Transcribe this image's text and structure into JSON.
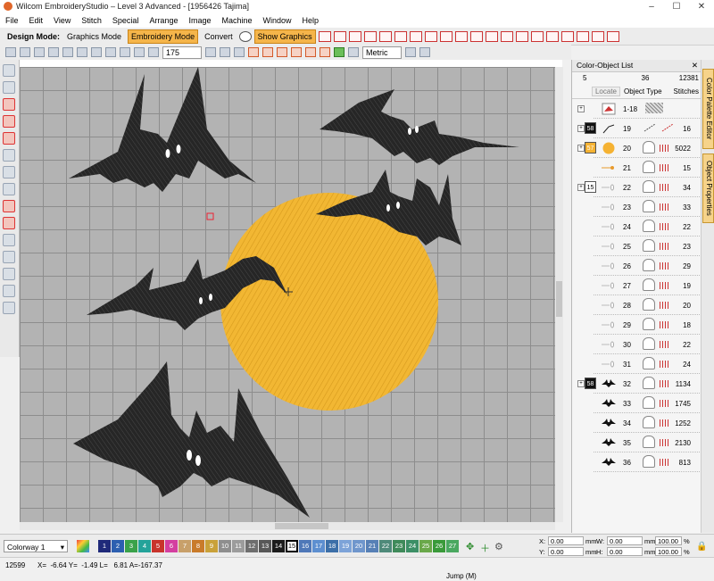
{
  "window": {
    "title": "Wilcom EmbroideryStudio – Level 3 Advanced - [1956426        Tajima]",
    "controls": [
      "–",
      "☐",
      "✕"
    ]
  },
  "menu": [
    "File",
    "Edit",
    "View",
    "Stitch",
    "Special",
    "Arrange",
    "Image",
    "Machine",
    "Window",
    "Help"
  ],
  "modebar": {
    "label": "Design Mode:",
    "graphics_mode": "Graphics Mode",
    "embroidery_mode": "Embroidery Mode",
    "convert": "Convert",
    "show_graphics": "Show Graphics"
  },
  "toolbar2": {
    "zoom": "175",
    "units": "Metric"
  },
  "panel": {
    "title": "Color-Object List",
    "close": "✕",
    "pin": "📌",
    "summary": {
      "colors": "5",
      "objects": "36",
      "stitches": "12381"
    },
    "cols": {
      "locate": "Locate",
      "object_type": "Object Type",
      "stitches": "Stitches"
    },
    "rows": [
      {
        "num": "1-18",
        "stitches": "",
        "swatch": "",
        "swatch_color": "",
        "kind": "group"
      },
      {
        "num": "19",
        "stitches": "16",
        "swatch": "58",
        "swatch_color": "#111111",
        "kind": "line"
      },
      {
        "num": "20",
        "stitches": "5022",
        "swatch": "57",
        "swatch_color": "#f5b232",
        "kind": "moon"
      },
      {
        "num": "21",
        "stitches": "15",
        "swatch": "",
        "swatch_color": "",
        "kind": "dot"
      },
      {
        "num": "22",
        "stitches": "34",
        "swatch": "15",
        "swatch_color": "#ffffff",
        "kind": "white"
      },
      {
        "num": "23",
        "stitches": "33",
        "swatch": "",
        "swatch_color": "",
        "kind": "white"
      },
      {
        "num": "24",
        "stitches": "22",
        "swatch": "",
        "swatch_color": "",
        "kind": "white"
      },
      {
        "num": "25",
        "stitches": "23",
        "swatch": "",
        "swatch_color": "",
        "kind": "white"
      },
      {
        "num": "26",
        "stitches": "29",
        "swatch": "",
        "swatch_color": "",
        "kind": "white"
      },
      {
        "num": "27",
        "stitches": "19",
        "swatch": "",
        "swatch_color": "",
        "kind": "white"
      },
      {
        "num": "28",
        "stitches": "20",
        "swatch": "",
        "swatch_color": "",
        "kind": "white"
      },
      {
        "num": "29",
        "stitches": "18",
        "swatch": "",
        "swatch_color": "",
        "kind": "white"
      },
      {
        "num": "30",
        "stitches": "22",
        "swatch": "",
        "swatch_color": "",
        "kind": "white"
      },
      {
        "num": "31",
        "stitches": "24",
        "swatch": "",
        "swatch_color": "",
        "kind": "white"
      },
      {
        "num": "32",
        "stitches": "1134",
        "swatch": "58",
        "swatch_color": "#111111",
        "kind": "bat"
      },
      {
        "num": "33",
        "stitches": "1745",
        "swatch": "",
        "swatch_color": "",
        "kind": "bat"
      },
      {
        "num": "34",
        "stitches": "1252",
        "swatch": "",
        "swatch_color": "",
        "kind": "bat"
      },
      {
        "num": "35",
        "stitches": "2130",
        "swatch": "",
        "swatch_color": "",
        "kind": "bat"
      },
      {
        "num": "36",
        "stitches": "813",
        "swatch": "",
        "swatch_color": "",
        "kind": "bat"
      }
    ],
    "side_tabs": [
      "Color Palette Editor",
      "Object Properties"
    ]
  },
  "colorway": {
    "name": "Colorway 1",
    "selected": "15"
  },
  "chips": [
    {
      "n": "1",
      "c": "#1f2a7a"
    },
    {
      "n": "2",
      "c": "#2c5fb0"
    },
    {
      "n": "3",
      "c": "#3aa24a"
    },
    {
      "n": "4",
      "c": "#24a39a"
    },
    {
      "n": "5",
      "c": "#c8342c"
    },
    {
      "n": "6",
      "c": "#d43fa0"
    },
    {
      "n": "7",
      "c": "#c8a06a"
    },
    {
      "n": "8",
      "c": "#c97b2a"
    },
    {
      "n": "9",
      "c": "#c9a13a"
    },
    {
      "n": "10",
      "c": "#8e8e8e"
    },
    {
      "n": "11",
      "c": "#9c9c9c"
    },
    {
      "n": "12",
      "c": "#6e6e6e"
    },
    {
      "n": "13",
      "c": "#585858"
    },
    {
      "n": "14",
      "c": "#1c1c1c"
    },
    {
      "n": "15",
      "c": "#ffffff"
    },
    {
      "n": "16",
      "c": "#4f78b8"
    },
    {
      "n": "17",
      "c": "#5d8fd0"
    },
    {
      "n": "18",
      "c": "#3c6fa8"
    },
    {
      "n": "19",
      "c": "#7da3d8"
    },
    {
      "n": "20",
      "c": "#6f96cc"
    },
    {
      "n": "21",
      "c": "#5780b6"
    },
    {
      "n": "22",
      "c": "#4f8a7a"
    },
    {
      "n": "23",
      "c": "#3f8a5a"
    },
    {
      "n": "24",
      "c": "#3c8f66"
    },
    {
      "n": "25",
      "c": "#6aa84a"
    },
    {
      "n": "26",
      "c": "#3a9a3a"
    },
    {
      "n": "27",
      "c": "#4aa860"
    }
  ],
  "coords": {
    "x_label": "X:",
    "x": "0.00",
    "y_label": "Y:",
    "y": "0.00",
    "w_label": "W:",
    "w": "0.00",
    "h_label": "H:",
    "h": "0.00",
    "unit": "mm",
    "w_pct": "100.00",
    "h_pct": "100.00",
    "pct": "%"
  },
  "status": {
    "count": "12599",
    "position": "X=  -6.64 Y=  -1.49 L=   6.81 A=-167.37",
    "message": "Jump (M)"
  }
}
